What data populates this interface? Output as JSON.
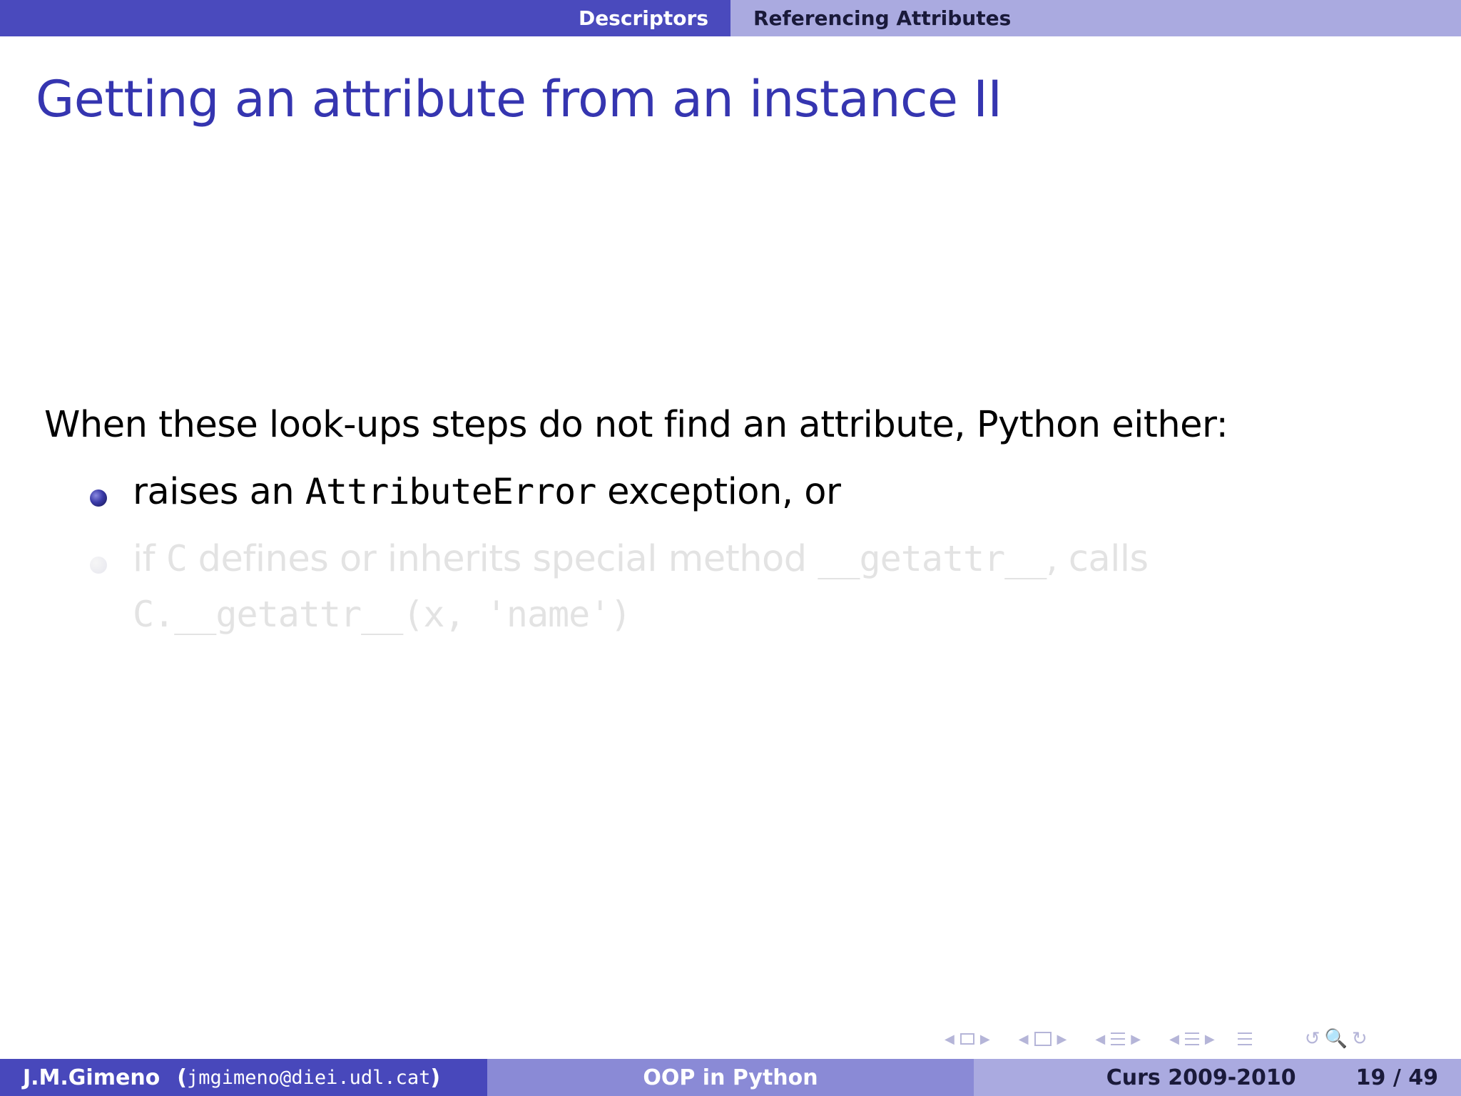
{
  "header": {
    "section": "Descriptors",
    "subsection": "Referencing Attributes"
  },
  "frame": {
    "title": "Getting an attribute from an instance II"
  },
  "content": {
    "intro": "When these look-ups steps do not find an attribute, Python either:",
    "items": [
      {
        "text_before": "raises an ",
        "code": "AttributeError",
        "text_after": " exception, or"
      },
      {
        "text_before": "if ",
        "code_class": "C",
        "text_middle": " defines or inherits special method ",
        "code_method": "__getattr__",
        "text_after": ", calls",
        "code_call": "C.__getattr__(x, 'name')"
      }
    ]
  },
  "footer": {
    "author": "J.M.Gimeno",
    "email": "jmgimeno@diei.udl.cat",
    "title": "OOP in Python",
    "course": "Curs 2009-2010",
    "page": "19 / 49"
  },
  "colors": {
    "title": "#3535b0",
    "header_dark": "#4a4abd",
    "header_light": "#aaaae0",
    "footer_mid": "#8a8ad6",
    "faded_text": "#e3e3e3"
  },
  "icons": {
    "nav": [
      "arrow-left-icon",
      "frame-icon",
      "arrow-right-icon",
      "subsection-icon",
      "section-icon",
      "outline-icon",
      "search-icon"
    ]
  }
}
